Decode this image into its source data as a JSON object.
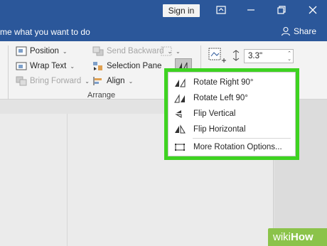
{
  "titlebar": {
    "signin_label": "Sign in"
  },
  "tellbar": {
    "tellme_text": "me what you want to do",
    "share_label": "Share"
  },
  "ribbon": {
    "position_label": "Position",
    "wrap_text_label": "Wrap Text",
    "bring_forward_label": "Bring Forward",
    "send_backward_label": "Send Backward",
    "selection_pane_label": "Selection Pane",
    "align_label": "Align",
    "arrange_group_label": "Arrange",
    "height_value": "3.3\""
  },
  "rotate_menu": {
    "items": [
      {
        "label": "Rotate Right 90°",
        "icon": "rotate-right-icon"
      },
      {
        "label": "Rotate Left 90°",
        "icon": "rotate-left-icon"
      },
      {
        "label": "Flip Vertical",
        "icon": "flip-vertical-icon"
      },
      {
        "label": "Flip Horizontal",
        "icon": "flip-horizontal-icon"
      },
      {
        "label": "More Rotation Options...",
        "icon": "rotation-options-icon"
      }
    ]
  },
  "watermark": {
    "part1": "wiki",
    "part2": "How"
  },
  "colors": {
    "titlebar": "#2b579a",
    "highlight": "#3ed321",
    "watermark": "#8bc34a"
  }
}
